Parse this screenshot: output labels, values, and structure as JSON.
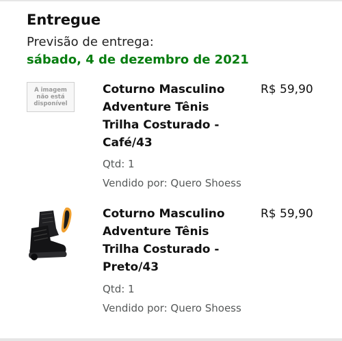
{
  "delivery": {
    "status": "Entregue",
    "forecast_label": "Previsão de entrega:",
    "forecast_date": "sábado, 4 de dezembro de 2021"
  },
  "items": [
    {
      "image_placeholder": "A imagem não está disponível",
      "title": "Coturno Masculino Adventure Tênis Trilha Costurado - Café/43",
      "price": "R$ 59,90",
      "qty": "Qtd: 1",
      "seller": "Vendido por: Quero Shoess"
    },
    {
      "image_icon": "boot-product-icon",
      "title": "Coturno Masculino Adventure Tênis Trilha Costurado - Preto/43",
      "price": "R$ 59,90",
      "qty": "Qtd: 1",
      "seller": "Vendido por: Quero Shoess"
    }
  ],
  "colors": {
    "date_green": "#067d0f",
    "secondary_gray": "#565959",
    "insole_orange": "#f0a030"
  }
}
